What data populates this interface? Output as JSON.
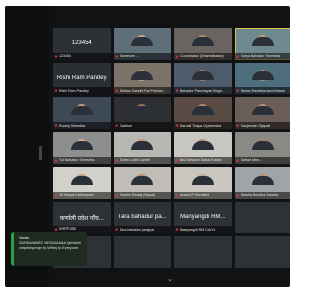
{
  "meeting": {
    "expand_label": "⌄"
  },
  "chat_toast": {
    "sender": "Vanto",
    "message": "SARNAWARC INSDAAAAA ljsbhbnhcmplhmpmqn fo Wfhej to Everyone"
  },
  "tiles": [
    {
      "name": "123454",
      "bigname": "123454",
      "face": null,
      "bg": "#2d3035"
    },
    {
      "name": "Someone ...",
      "bigname": "",
      "face": "#c9a27b",
      "bg": "#5e6f7a"
    },
    {
      "name": "Coordinator (Dhanbahadur)",
      "bigname": "",
      "face": "#b78a66",
      "bg": "#6a6460"
    },
    {
      "name": "Surya Bahadur Shrestha",
      "bigname": "",
      "face": "#c59a73",
      "bg": "#6f8a8e",
      "active": true
    },
    {
      "name": "Rishi Ram Pandey",
      "bigname": "Rishi Ram Pandey",
      "face": null,
      "bg": "#2b2e33"
    },
    {
      "name": "Bidhan Gandhi Rai Pokhari...",
      "bigname": "",
      "face": "#caa383",
      "bg": "#7c7268"
    },
    {
      "name": "Bahadur Panchayat Singh...",
      "bigname": "",
      "face": "#a67c5c",
      "bg": "#4d5b6b"
    },
    {
      "name": "Tanka Shrestha lamichhane",
      "bigname": "",
      "face": "#b78e6e",
      "bg": "#4f6e7d"
    },
    {
      "name": "Rudraj Shrestha",
      "bigname": "",
      "face": "#c59b7a",
      "bg": "#3d4a55"
    },
    {
      "name": "Gadkuri",
      "bigname": "",
      "face": "#9a7658",
      "bg": "#2e2f33"
    },
    {
      "name": "Karnali Thapa Gyanendra",
      "bigname": "",
      "face": "#b58a68",
      "bg": "#5a4a44"
    },
    {
      "name": "Sanjeevan Sijapati",
      "bigname": "",
      "face": "#c09172",
      "bg": "#6b5e58"
    },
    {
      "name": "Tul Bahadur Shrestha...",
      "bigname": "",
      "face": "#d1a98a",
      "bg": "#8d8f8c"
    },
    {
      "name": "Suma Luitel Luintel",
      "bigname": "",
      "face": "#c59c7e",
      "bg": "#b7b7b3"
    },
    {
      "name": "Bal Bahadur Dahal Kodari",
      "bigname": "",
      "face": "#ba8e6e",
      "bg": "#c9c7c2"
    },
    {
      "name": "Sarkar Mun....",
      "bigname": "",
      "face": "#a98063",
      "bg": "#8a8986"
    },
    {
      "name": "Vit Nepali Kathmandu",
      "bigname": "",
      "face": "#c49a78",
      "bg": "#d1d0cb"
    },
    {
      "name": "Suresh Reddy (Nepal)",
      "bigname": "",
      "face": "#b98f6e",
      "bg": "#bfbdb6"
    },
    {
      "name": "Anand R Shrestha",
      "bigname": "",
      "face": "#c7a284",
      "bg": "#c8c6bf"
    },
    {
      "name": "Barsha Boudha Sandes",
      "bigname": "",
      "face": "#b88d6c",
      "bg": "#9fa4a8"
    },
    {
      "name": "कर्णाली प्रदेश",
      "bigname": "कर्णाली प्रदेश पाँच...",
      "face": null,
      "bg": "#2e3136"
    },
    {
      "name": "Tara bahadur panjiyar",
      "bigname": "Tara bahadur pa...",
      "face": null,
      "bg": "#2e3136"
    },
    {
      "name": "Manyangdi RM CAO's",
      "bigname": "Manyangdi RM...",
      "face": null,
      "bg": "#2e3136"
    },
    {
      "name": "",
      "bigname": "",
      "face": null,
      "bg": "#2e3136"
    },
    {
      "name": "",
      "bigname": "",
      "face": null,
      "bg": "#2e3136"
    },
    {
      "name": "",
      "bigname": "",
      "face": null,
      "bg": "#2e3136"
    },
    {
      "name": "",
      "bigname": "",
      "face": null,
      "bg": "#2e3136"
    },
    {
      "name": "",
      "bigname": "",
      "face": null,
      "bg": "#2e3136"
    }
  ]
}
